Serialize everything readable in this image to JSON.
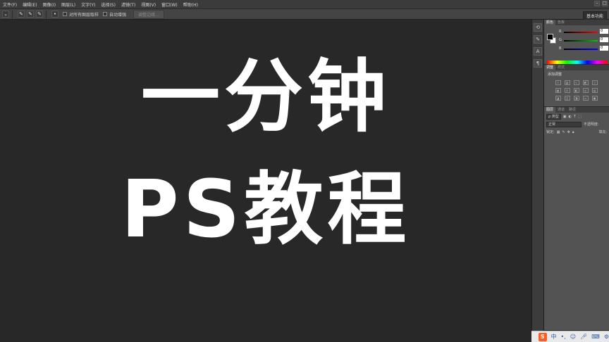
{
  "menu": [
    "文件(F)",
    "编辑(E)",
    "图像(I)",
    "图层(L)",
    "文字(Y)",
    "选择(S)",
    "滤镜(T)",
    "视图(V)",
    "窗口(W)",
    "帮助(H)"
  ],
  "window_controls": [
    "–",
    "□"
  ],
  "options": {
    "sample_all_layers": "对所有图层取样",
    "auto_enhance": "自动增强",
    "refine_edge": "调整边缘...",
    "workspace": "基本功能"
  },
  "canvas": {
    "line1": "一分钟",
    "line2": "PS教程"
  },
  "dock_icons": [
    "history-icon",
    "brush-icon",
    "type-icon",
    "paragraph-icon"
  ],
  "color_panel": {
    "tabs": [
      "颜色",
      "色板"
    ],
    "sliders": [
      {
        "label": "R",
        "value": "0",
        "color": "#e03030"
      },
      {
        "label": "G",
        "value": "0",
        "color": "#30b030"
      },
      {
        "label": "B",
        "value": "0",
        "color": "#3050e0"
      }
    ]
  },
  "adjust_panel": {
    "tabs": [
      "调整",
      "样式"
    ],
    "title": "添加调整"
  },
  "layers_panel": {
    "tabs": [
      "图层",
      "通道",
      "路径"
    ],
    "kind_filter": "ρ 类型",
    "blend_mode": "正常",
    "opacity_label": "不透明度:",
    "lock_label": "锁定:",
    "fill_label": "填充:"
  },
  "taskbar": {
    "ime_logo": "S",
    "ime_mode": "中"
  }
}
